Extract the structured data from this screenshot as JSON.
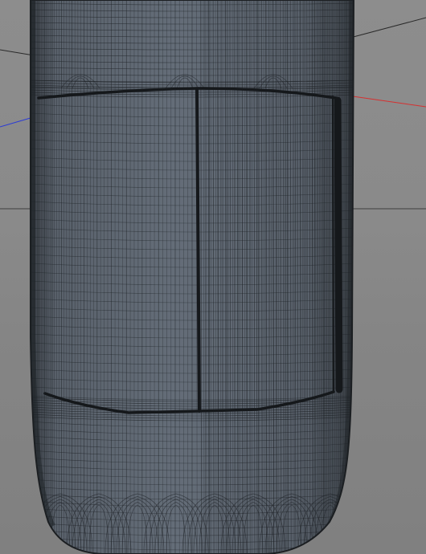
{
  "viewport": {
    "background": "#8a8a8a",
    "horizon_line_color": "#3d3d3d",
    "axes": {
      "x_axis_color": "#d63030",
      "z_axis_color": "#2a3ad6",
      "y_axis_color": "#202020"
    }
  },
  "model": {
    "name_icon": "capsule-wireframe-icon",
    "surface_color": "#5e6670",
    "surface_highlight": "#6b7480",
    "wire_color": "#1e2226",
    "seam_color": "#15181b"
  }
}
